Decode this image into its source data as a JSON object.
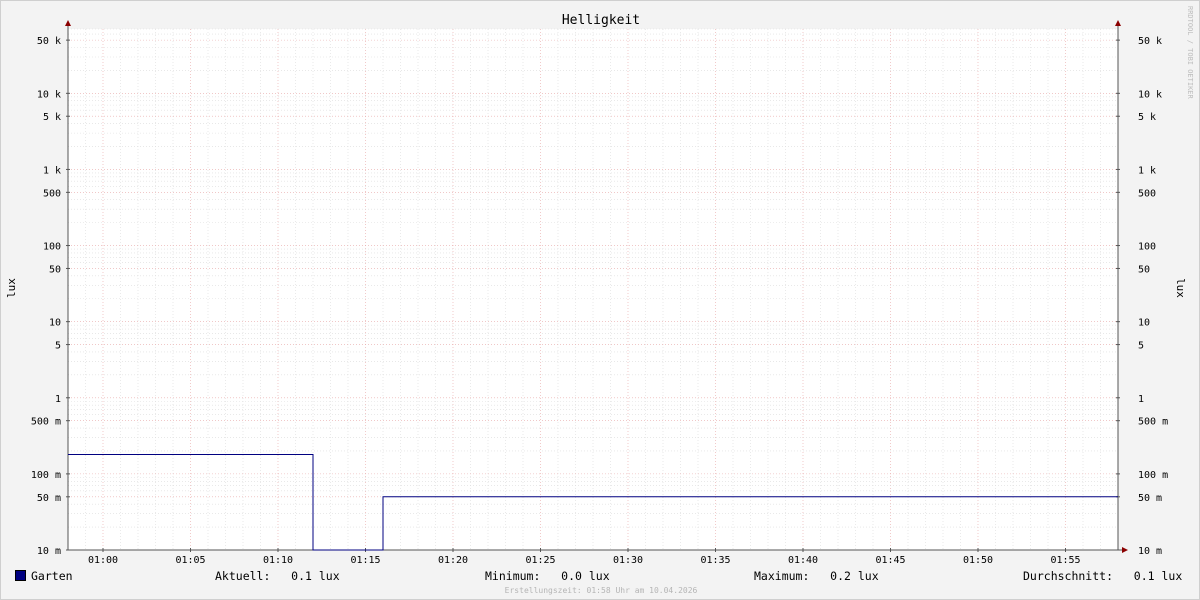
{
  "chart_data": {
    "type": "line",
    "title": "Helligkeit",
    "ylabel": "lux",
    "yscale": "log",
    "ylim": [
      0.01,
      70000
    ],
    "yticks": [
      {
        "value": 50000,
        "label": "50 k"
      },
      {
        "value": 10000,
        "label": "10 k"
      },
      {
        "value": 5000,
        "label": "5 k"
      },
      {
        "value": 1000,
        "label": "1 k"
      },
      {
        "value": 500,
        "label": "500"
      },
      {
        "value": 100,
        "label": "100"
      },
      {
        "value": 50,
        "label": "50"
      },
      {
        "value": 10,
        "label": "10"
      },
      {
        "value": 5,
        "label": "5"
      },
      {
        "value": 1,
        "label": "1"
      },
      {
        "value": 0.5,
        "label": "500 m"
      },
      {
        "value": 0.1,
        "label": "100 m"
      },
      {
        "value": 0.05,
        "label": "50 m"
      },
      {
        "value": 0.01,
        "label": "10 m"
      }
    ],
    "xlim": [
      "00:58",
      "01:58"
    ],
    "xticks": [
      "01:00",
      "01:05",
      "01:10",
      "01:15",
      "01:20",
      "01:25",
      "01:30",
      "01:35",
      "01:40",
      "01:45",
      "01:50",
      "01:55"
    ],
    "grid": true,
    "series": [
      {
        "name": "Garten",
        "color": "#000080",
        "points": [
          {
            "x": "00:58",
            "y": 0.18
          },
          {
            "x": "01:12",
            "y": 0.18
          },
          {
            "x": "01:12",
            "y": 0.01
          },
          {
            "x": "01:16",
            "y": 0.01
          },
          {
            "x": "01:16",
            "y": 0.05
          },
          {
            "x": "01:58",
            "y": 0.05
          }
        ]
      }
    ]
  },
  "legend": {
    "series_name": "Garten",
    "swatch_color": "#000080",
    "current_label": "Aktuell:",
    "current_value": "0.1 lux",
    "min_label": "Minimum:",
    "min_value": "0.0 lux",
    "max_label": "Maximum:",
    "max_value": "0.2 lux",
    "avg_label": "Durchschnitt:",
    "avg_value": "0.1 lux"
  },
  "watermark": "RRDTOOL / TOBI OETIKER",
  "footer": "Erstellungszeit: 01:58 Uhr am 10.04.2026"
}
